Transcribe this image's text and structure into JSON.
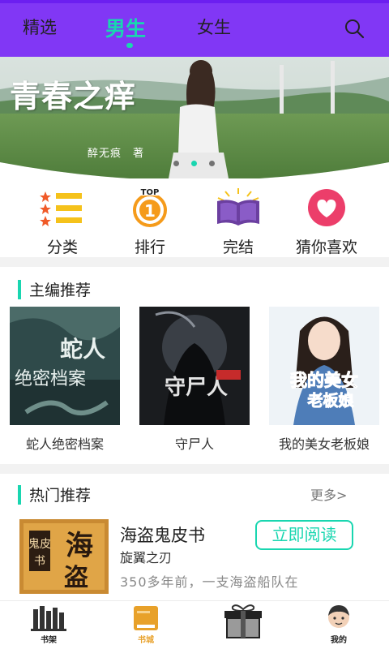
{
  "tabs": [
    {
      "label": "精选"
    },
    {
      "label": "男生",
      "active": true
    },
    {
      "label": "女生"
    }
  ],
  "banner": {
    "title": "青春之痒",
    "author": "醉无痕　著",
    "dots_active_index": 1,
    "dots_total": 3
  },
  "categories": [
    {
      "label": "分类",
      "icon": "list-icon"
    },
    {
      "label": "排行",
      "icon": "top1-medal-icon",
      "badge": "TOP",
      "number": "1"
    },
    {
      "label": "完结",
      "icon": "open-book-icon"
    },
    {
      "label": "猜你喜欢",
      "icon": "heart-icon"
    }
  ],
  "editor_section": {
    "title": "主编推荐",
    "books": [
      {
        "name": "蛇人绝密档案",
        "cover_text": "蛇人绝密档案"
      },
      {
        "name": "守尸人",
        "cover_text": "守尸人"
      },
      {
        "name": "我的美女老板娘",
        "cover_text": "我的美女老板娘"
      }
    ]
  },
  "hot_section": {
    "title": "热门推荐",
    "more": "更多>",
    "book": {
      "title": "海盗鬼皮书",
      "author": "旋翼之刃",
      "description": "350多年前，一支海盗船队在",
      "button": "立即阅读",
      "cover_text": "海盗鬼皮书"
    }
  },
  "bottom_nav": [
    {
      "label": "书架",
      "icon": "bookshelf-icon"
    },
    {
      "label": "书城",
      "icon": "book-city-icon",
      "active": true
    },
    {
      "label": "",
      "icon": "gift-icon"
    },
    {
      "label": "我的",
      "icon": "profile-avatar-icon"
    }
  ],
  "colors": {
    "header": "#8137f5",
    "accent": "#19d6b0",
    "active_nav": "#e8a12a"
  }
}
